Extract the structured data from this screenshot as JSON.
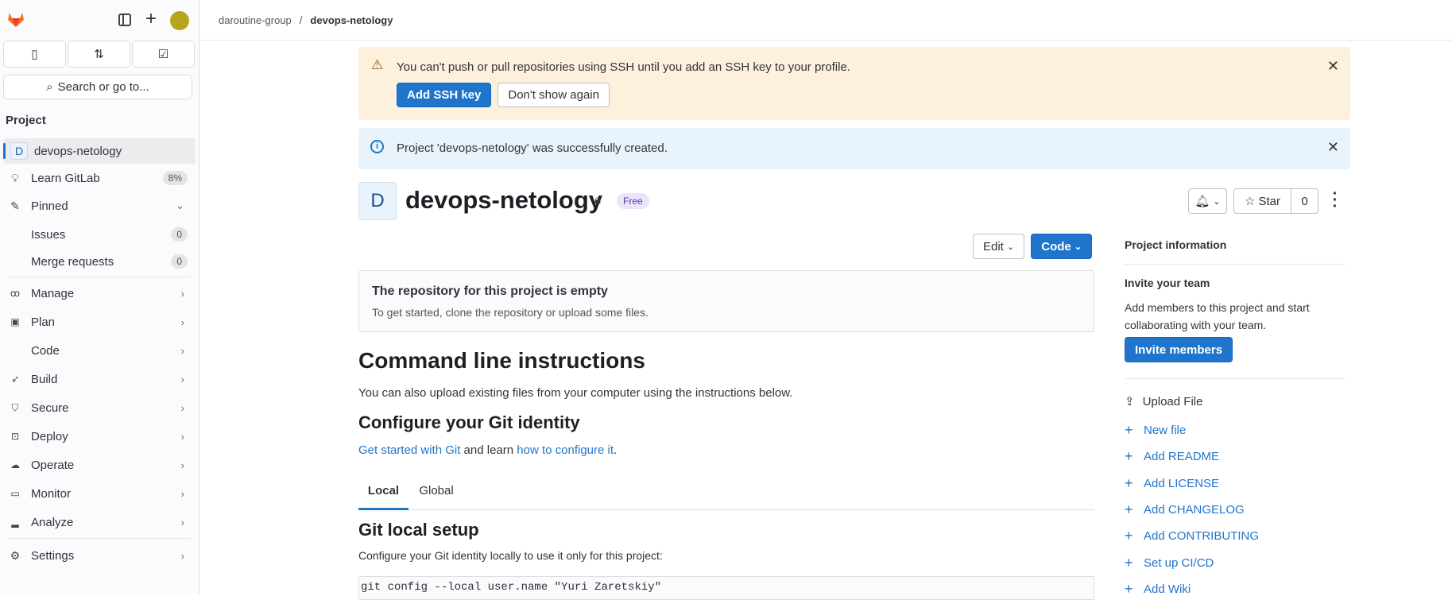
{
  "sidebar": {
    "section_title": "Project",
    "project": {
      "initial": "D",
      "name": "devops-netology"
    },
    "learn": {
      "label": "Learn GitLab",
      "badge": "8%"
    },
    "pinned": {
      "label": "Pinned",
      "items": [
        {
          "label": "Issues",
          "count": "0"
        },
        {
          "label": "Merge requests",
          "count": "0"
        }
      ]
    },
    "items": [
      {
        "label": "Manage",
        "icon": "users-icon"
      },
      {
        "label": "Plan",
        "icon": "calendar-icon"
      },
      {
        "label": "Code",
        "icon": "code-icon"
      },
      {
        "label": "Build",
        "icon": "rocket-icon"
      },
      {
        "label": "Secure",
        "icon": "shield-icon"
      },
      {
        "label": "Deploy",
        "icon": "deploy-icon"
      },
      {
        "label": "Operate",
        "icon": "cloud-gear-icon"
      },
      {
        "label": "Monitor",
        "icon": "monitor-icon"
      },
      {
        "label": "Analyze",
        "icon": "chart-icon"
      }
    ],
    "settings": "Settings",
    "search_label": "Search or go to..."
  },
  "breadcrumb": {
    "group": "daroutine-group",
    "sep": "/",
    "project": "devops-netology"
  },
  "ssh_banner": {
    "text": "You can't push or pull repositories using SSH until you add an SSH key to your profile.",
    "add": "Add SSH key",
    "dismiss": "Don't show again"
  },
  "info_banner": {
    "text": "Project 'devops-netology' was successfully created."
  },
  "project": {
    "initial": "D",
    "title": "devops-netology",
    "badge": "Free",
    "star_label": "Star",
    "star_count": "0"
  },
  "actions": {
    "edit": "Edit",
    "code": "Code"
  },
  "empty": {
    "title": "The repository for this project is empty",
    "text": "To get started, clone the repository or upload some files."
  },
  "cli": {
    "title": "Command line instructions",
    "intro": "You can also upload existing files from your computer using the instructions below.",
    "identity_title": "Configure your Git identity",
    "link1": "Get started with Git",
    "mid": " and learn ",
    "link2": "how to configure it",
    "end": ".",
    "tabs": [
      "Local",
      "Global"
    ],
    "local_title": "Git local setup",
    "local_text": "Configure your Git identity locally to use it only for this project:",
    "code": "git config --local user.name \"Yuri Zaretskiy\""
  },
  "right": {
    "info_title": "Project information",
    "invite_title": "Invite your team",
    "invite_text1": "Add members to this project and start",
    "invite_text2": "collaborating with your team.",
    "invite_btn": "Invite members",
    "upload": "Upload File",
    "links": [
      "New file",
      "Add README",
      "Add LICENSE",
      "Add CHANGELOG",
      "Add CONTRIBUTING",
      "Set up CI/CD",
      "Add Wiki"
    ]
  },
  "colors": {
    "primary": "#1f75cb",
    "warning_bg": "#fdf1dd",
    "info_bg": "#e9f3fc"
  }
}
